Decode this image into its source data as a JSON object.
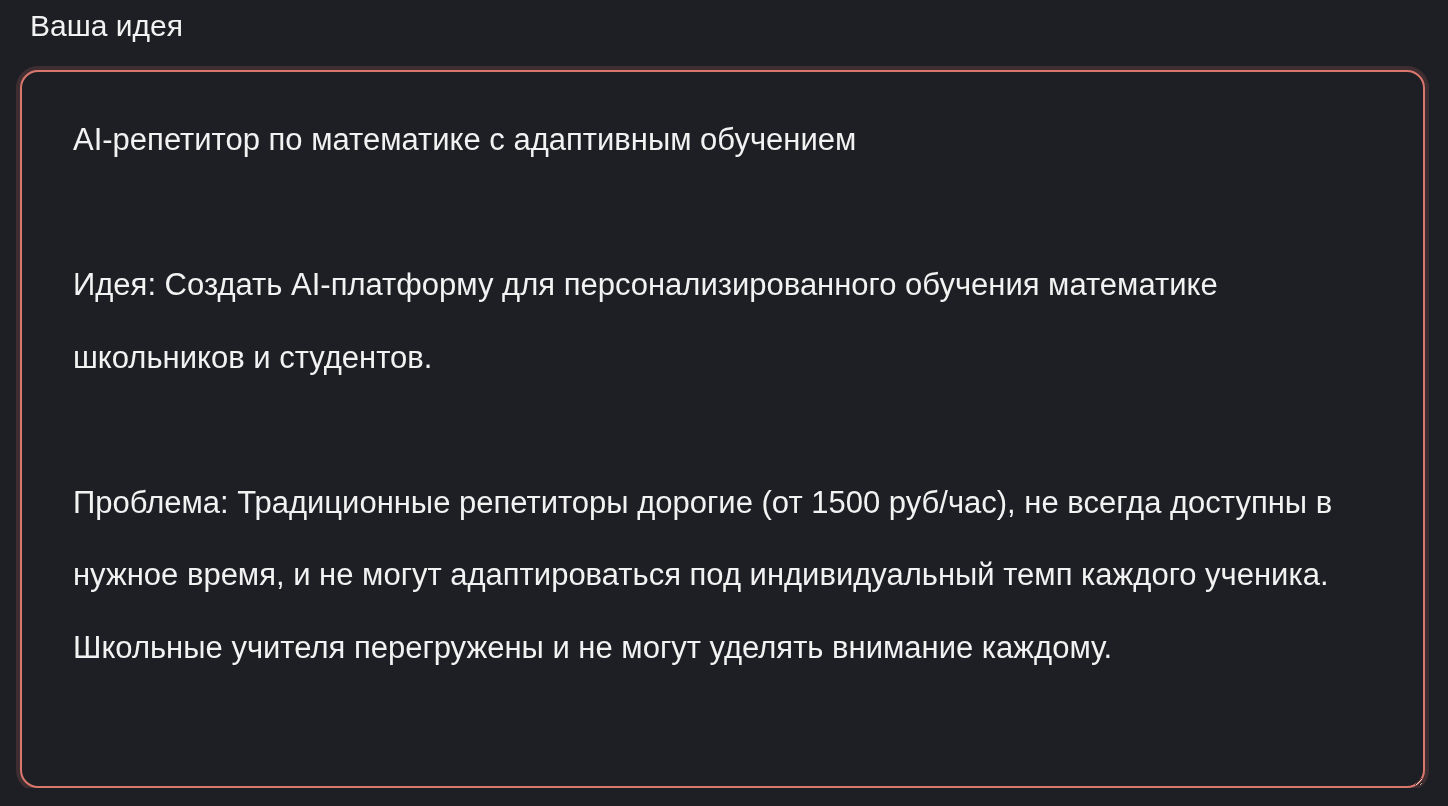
{
  "label": "Ваша идея",
  "idea_field": {
    "value": "AI-репетитор по математике с адаптивным обучением\n\nИдея: Создать AI-платформу для персонализированного обучения математике школьников и студентов.\n\nПроблема: Традиционные репетиторы дорогие (от 1500 руб/час), не всегда доступны в нужное время, и не могут адаптироваться под индивидуальный темп каждого ученика. Школьные учителя перегружены и не могут уделять внимание каждому.",
    "focused": true
  }
}
